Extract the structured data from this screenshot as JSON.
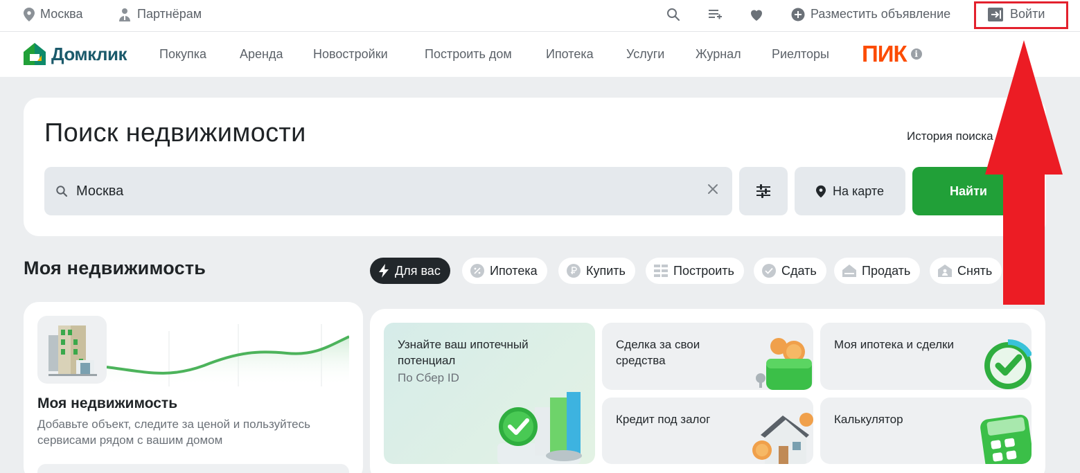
{
  "topbar": {
    "city": "Москва",
    "partners": "Партнёрам",
    "place_ad": "Разместить объявление",
    "login": "Войти"
  },
  "nav": {
    "logo": "Домклик",
    "links": [
      "Покупка",
      "Аренда",
      "Новостройки",
      "Построить дом",
      "Ипотека",
      "Услуги",
      "Журнал",
      "Риелторы"
    ],
    "partner_logo": "ПИК",
    "info": "i"
  },
  "search": {
    "title": "Поиск недвижимости",
    "history": "История поиска",
    "value": "Москва",
    "map_button": "На карте",
    "find_button": "Найти"
  },
  "my_realty": {
    "title": "Моя недвижимость",
    "chips": [
      "Для вас",
      "Ипотека",
      "Купить",
      "Построить",
      "Сдать",
      "Продать",
      "Снять"
    ],
    "card_title": "Моя недвижимость",
    "card_desc": "Добавьте объект, следите за ценой и пользуйтесь сервисами рядом с вашим домом"
  },
  "tiles": {
    "potential_title": "Узнайте ваш ипотечный потенциал",
    "potential_sub": "По Сбер ID",
    "deal_title": "Сделка за свои средства",
    "mortgage_title": "Моя ипотека и сделки",
    "credit_title": "Кредит под залог",
    "calc_title": "Калькулятор"
  },
  "colors": {
    "accent_green": "#21a038",
    "pik_orange": "#fc4c02",
    "highlight_red": "#e3212d"
  }
}
